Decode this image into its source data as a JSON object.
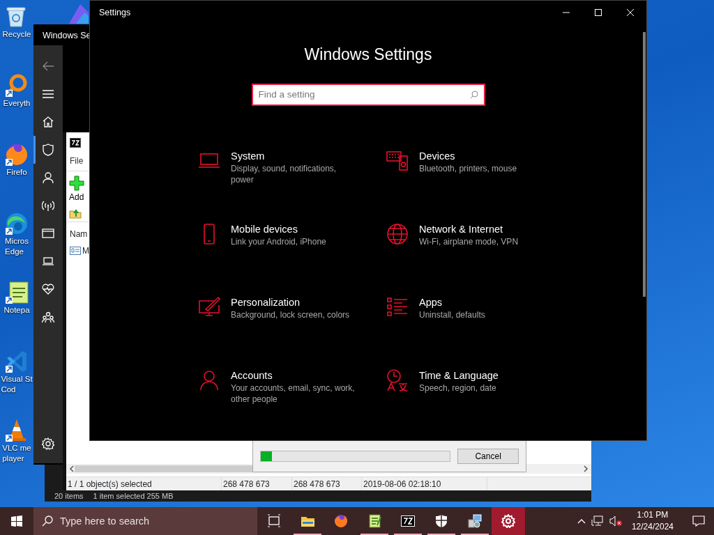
{
  "desktop_icons": [
    {
      "lines": [
        "Recycle"
      ]
    },
    {
      "lines": [
        "Everyth"
      ]
    },
    {
      "lines": [
        "Firefo"
      ]
    },
    {
      "lines": [
        "Micros",
        "Edge"
      ]
    },
    {
      "lines": [
        "Notepa"
      ]
    },
    {
      "lines": [
        "Visual St",
        "Cod"
      ]
    },
    {
      "lines": [
        "VLC me",
        "player"
      ]
    }
  ],
  "security_window": {
    "title": "Windows Se",
    "pages": [
      {
        "kind": "top",
        "selected": false
      },
      {
        "kind": "top",
        "selected": true
      },
      {
        "kind": "top",
        "selected": false
      },
      {
        "kind": "top",
        "selected": false
      },
      {
        "kind": "top",
        "selected": false
      },
      {
        "kind": "top",
        "selected": false
      },
      {
        "kind": "top",
        "selected": false
      },
      {
        "kind": "top",
        "selected": false
      },
      {
        "kind": "bottom",
        "selected": false
      }
    ]
  },
  "archive_window": {
    "menu": "File",
    "tool": "Add",
    "column": "Nam",
    "file": "M",
    "status": [
      "1 / 1 object(s) selected",
      "268 478 673",
      "268 478 673",
      "2019-08-06 02:18:10"
    ]
  },
  "explorer_status": [
    "20 items",
    "1 item selected  255 MB"
  ],
  "progress_dialog": {
    "level": 0.06,
    "button": "Cancel"
  },
  "settings": {
    "title": "Settings",
    "heading": "Windows Settings",
    "search": {
      "placeholder": "Find a setting"
    },
    "categories": [
      {
        "name": "System",
        "description": "Display, sound, notifications, power"
      },
      {
        "name": "Devices",
        "description": "Bluetooth, printers, mouse"
      },
      {
        "name": "Mobile devices",
        "description": "Link your Android, iPhone"
      },
      {
        "name": "Network & Internet",
        "description": "Wi-Fi, airplane mode, VPN"
      },
      {
        "name": "Personalization",
        "description": "Background, lock screen, colors"
      },
      {
        "name": "Apps",
        "description": "Uninstall, defaults"
      },
      {
        "name": "Accounts",
        "description": "Your accounts, email, sync, work, other people"
      },
      {
        "name": "Time & Language",
        "description": "Speech, region, date"
      }
    ]
  },
  "taskbar": {
    "search": {
      "placeholder": "Type here to search"
    },
    "apps": [
      {
        "running": false,
        "active": false
      },
      {
        "running": true,
        "active": false
      },
      {
        "running": false,
        "active": false
      },
      {
        "running": true,
        "active": false
      },
      {
        "running": true,
        "active": false
      },
      {
        "running": true,
        "active": false
      },
      {
        "running": true,
        "active": false
      },
      {
        "running": true,
        "active": true
      }
    ],
    "time": "1:01 PM",
    "date": "12/24/2024"
  }
}
